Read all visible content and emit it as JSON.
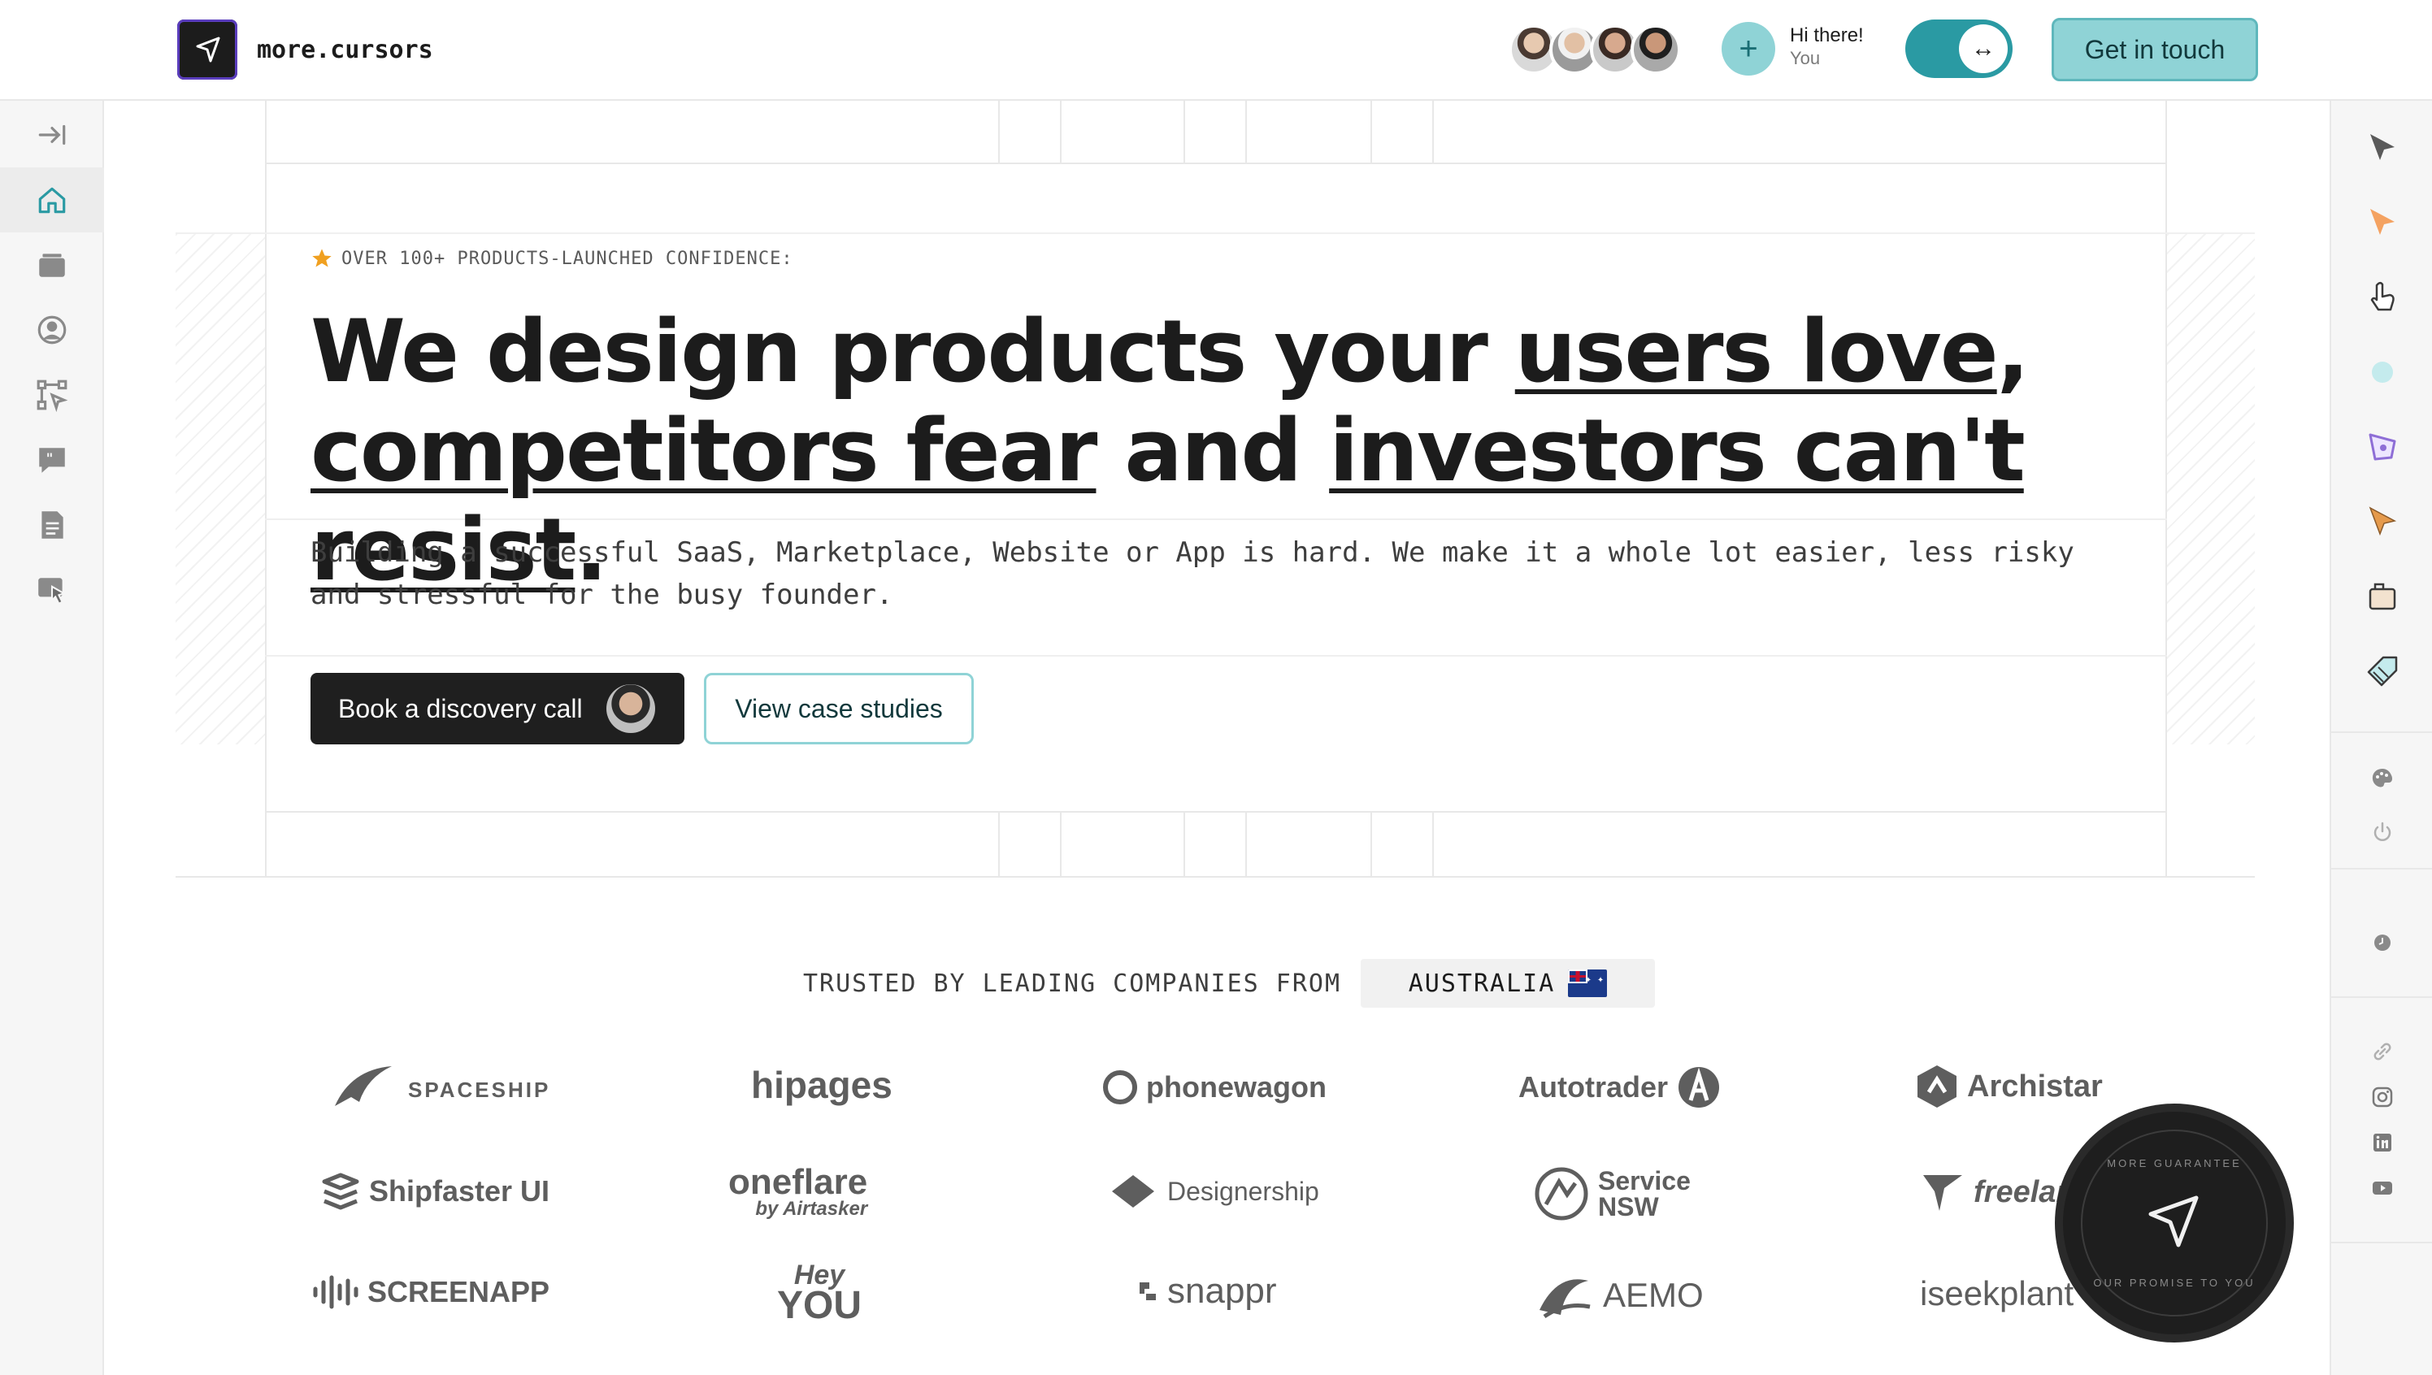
{
  "brand": {
    "name": "more.cursors"
  },
  "header": {
    "greeting": "Hi there!",
    "user": "You",
    "add_symbol": "+",
    "toggle_symbol": "↔",
    "cta_label": "Get in touch"
  },
  "left_sidebar": {
    "items": [
      {
        "icon": "collapse-icon"
      },
      {
        "icon": "home-icon"
      },
      {
        "icon": "briefcase-icon"
      },
      {
        "icon": "user-circle-icon"
      },
      {
        "icon": "flow-icon"
      },
      {
        "icon": "chat-quote-icon"
      },
      {
        "icon": "document-icon"
      },
      {
        "icon": "cursor-hand-icon"
      }
    ]
  },
  "right_sidebar": {
    "cursors": [
      "arrow-cursor-dark",
      "arrow-cursor-orange",
      "hand-cursor",
      "circle-cursor",
      "pen-cursor",
      "arrow-cursor-amber",
      "box-cursor",
      "tag-cursor"
    ],
    "tools": [
      "palette-icon",
      "power-icon",
      "clock-icon",
      "link-icon",
      "instagram-icon",
      "linkedin-icon",
      "youtube-icon"
    ]
  },
  "hero": {
    "eyebrow": "OVER 100+ PRODUCTS-LAUNCHED CONFIDENCE:",
    "headline_1": "We design products your ",
    "headline_u1": "users love",
    "headline_2": ",",
    "headline_u2": "competitors fear",
    "headline_3": " and ",
    "headline_u3": "investors can't resist",
    "headline_4": ".",
    "subcopy": "Building a successful SaaS, Marketplace, Website or App is hard. We make it a whole lot easier, less risky and stressful for the busy founder.",
    "primary_button": "Book a discovery call",
    "secondary_button": "View case studies"
  },
  "trusted": {
    "label": "TRUSTED BY LEADING COMPANIES FROM",
    "country": "AUSTRALIA"
  },
  "logos": [
    {
      "name": "SPACESHIP"
    },
    {
      "name": "hipages"
    },
    {
      "name": "phonewagon"
    },
    {
      "name": "Autotrader"
    },
    {
      "name": "Archistar"
    },
    {
      "name": "Shipfaster UI"
    },
    {
      "name": "oneflare",
      "sub": "by Airtasker"
    },
    {
      "name": "Designership"
    },
    {
      "name": "Service",
      "sub": "NSW"
    },
    {
      "name": "freelancer"
    },
    {
      "name": "SCREENAPP"
    },
    {
      "name": "Hey",
      "sub": "YOU"
    },
    {
      "name": "snappr"
    },
    {
      "name": "AEMO"
    },
    {
      "name": "iseekplant"
    }
  ],
  "badge": {
    "top": "MORE GUARANTEE",
    "bottom": "OUR PROMISE TO YOU"
  }
}
